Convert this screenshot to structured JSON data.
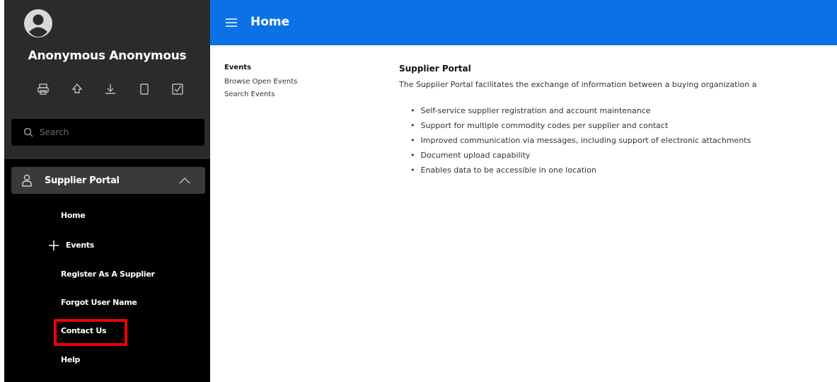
{
  "user": {
    "name": "Anonymous Anonymous"
  },
  "search": {
    "placeholder": "Search"
  },
  "sidebar": {
    "group_label": "Supplier Portal",
    "items": [
      {
        "label": "Home"
      },
      {
        "label": "Events"
      },
      {
        "label": "Register As A Supplier"
      },
      {
        "label": "Forgot User Name"
      },
      {
        "label": "Contact Us"
      },
      {
        "label": "Help"
      }
    ]
  },
  "header": {
    "title": "Home"
  },
  "events_panel": {
    "heading": "Events",
    "links": [
      "Browse Open Events",
      "Search Events"
    ]
  },
  "content": {
    "title": "Supplier Portal",
    "description": "The Supplier Portal facilitates the exchange of information between a buying organization a",
    "features": [
      "Self-service supplier registration and account maintenance",
      "Support for multiple commodity codes per supplier and contact",
      "Improved communication via messages, including support of electronic attachments",
      "Document upload capability",
      "Enables data to be accessible in one location"
    ]
  },
  "colors": {
    "header": "#0a72e6",
    "sidebar": "#000000",
    "sidebar_top": "#2b2b2b",
    "highlight": "#ee0000"
  }
}
